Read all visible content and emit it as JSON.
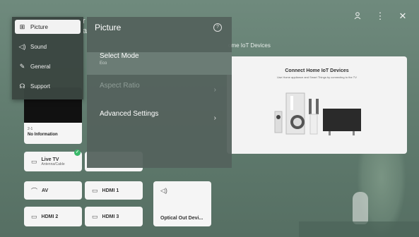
{
  "header": {
    "partial_title_char": "r",
    "partial_second_char": "a"
  },
  "top_icons": [
    "user-icon",
    "more-vertical-icon",
    "close-icon"
  ],
  "categories": [
    {
      "label": "Picture",
      "icon": "picture-icon",
      "active": true
    },
    {
      "label": "Sound",
      "icon": "speaker-icon",
      "active": false
    },
    {
      "label": "General",
      "icon": "wrench-icon",
      "active": false
    },
    {
      "label": "Support",
      "icon": "support-icon",
      "active": false
    }
  ],
  "panel": {
    "title": "Picture",
    "help_icon": "?",
    "items": [
      {
        "label": "Select Mode",
        "value": "Eco",
        "selected": true,
        "disabled": false
      },
      {
        "label": "Aspect Ratio",
        "value": "",
        "selected": false,
        "disabled": true
      },
      {
        "label": "Advanced Settings",
        "value": "",
        "selected": false,
        "disabled": false
      }
    ]
  },
  "iot": {
    "section_label": "ome IoT Devices",
    "title": "Connect Home IoT Devices",
    "subtitle": "Use Home appliance and Smart Things by connecting to the TV"
  },
  "channel": {
    "number": "2-1",
    "info": "No Information"
  },
  "tiles": {
    "live_tv": {
      "label": "Live TV",
      "sub": "Antenna/Cable"
    },
    "av": {
      "label": "AV"
    },
    "hdmi1": {
      "label": "HDMI 1"
    },
    "hdmi2": {
      "label": "HDMI 2"
    },
    "hdmi3": {
      "label": "HDMI 3"
    },
    "optical": {
      "label": "Optical Out Devi..."
    }
  },
  "colors": {
    "accent_green": "#3ab96a",
    "background": "#6f8a7d"
  }
}
